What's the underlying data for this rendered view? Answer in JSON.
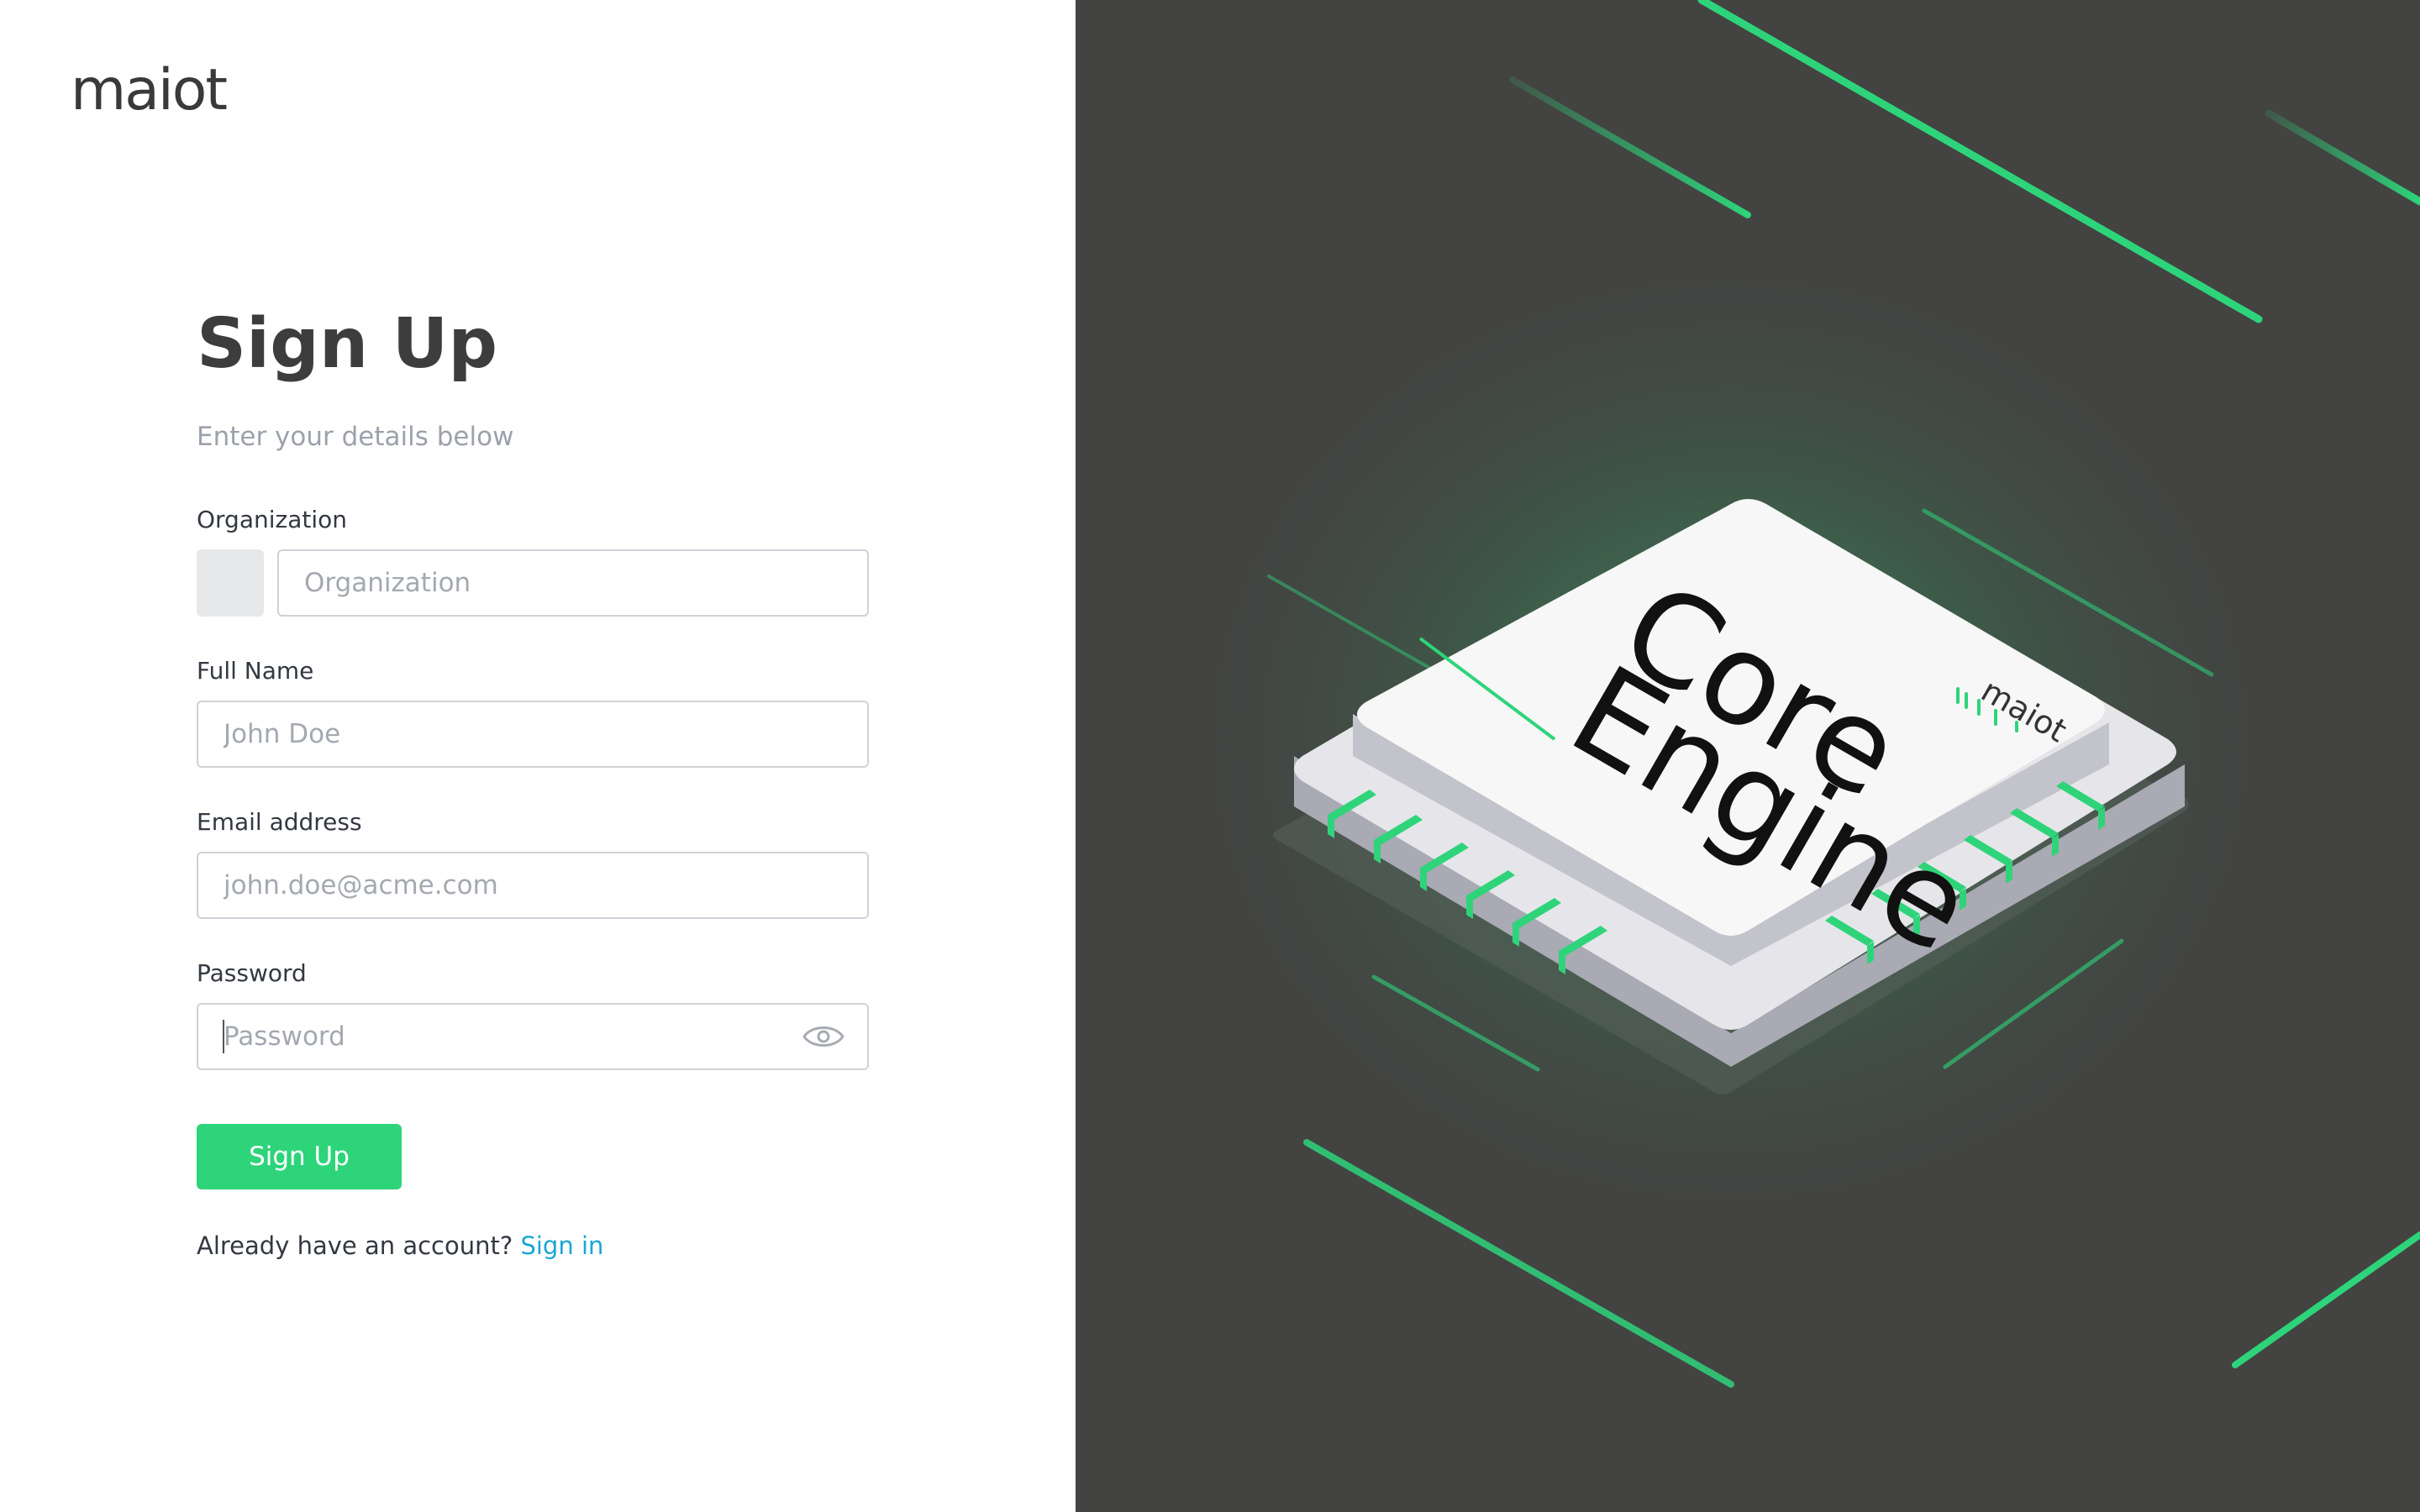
{
  "brand": {
    "logo_text": "maiot"
  },
  "form": {
    "title": "Sign Up",
    "subtitle": "Enter your details below",
    "organization": {
      "label": "Organization",
      "placeholder": "Organization",
      "value": ""
    },
    "full_name": {
      "label": "Full Name",
      "placeholder": "John Doe",
      "value": ""
    },
    "email": {
      "label": "Email address",
      "placeholder": "john.doe@acme.com",
      "value": ""
    },
    "password": {
      "label": "Password",
      "placeholder": "Password",
      "value": ""
    },
    "submit_label": "Sign Up",
    "signin_prompt": "Already have an account?",
    "signin_link": "Sign in"
  },
  "illustration": {
    "chip_line1": "Core",
    "chip_line2": "Engine",
    "chip_logo": "maiot"
  },
  "colors": {
    "accent": "#2ed47a",
    "link": "#1aa6d6",
    "dark_panel": "#434342",
    "title": "#3d3d3d",
    "muted": "#9ca1ab"
  },
  "icons": {
    "password_toggle": "eye-icon"
  }
}
